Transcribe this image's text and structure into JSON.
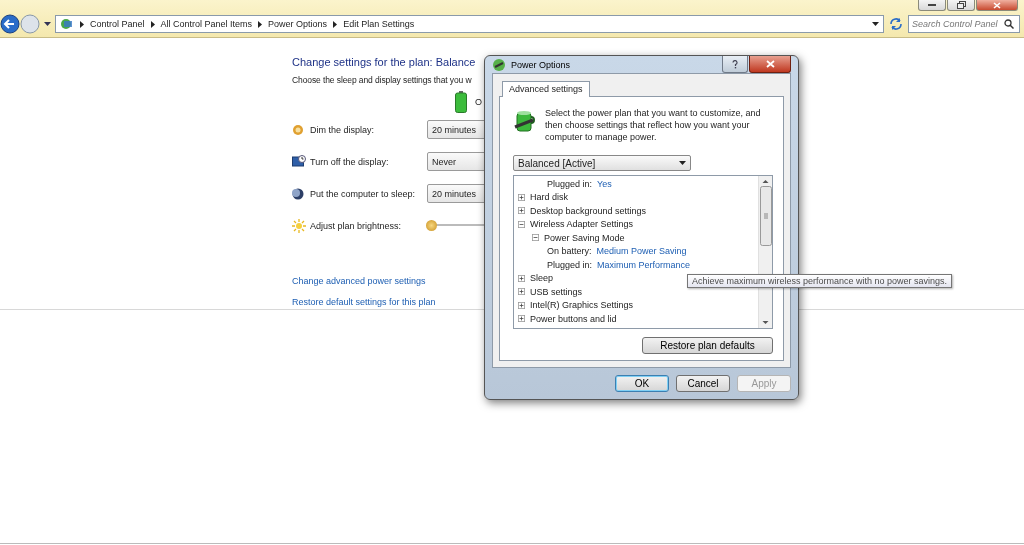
{
  "address_bar": {
    "crumbs": [
      "Control Panel",
      "All Control Panel Items",
      "Power Options",
      "Edit Plan Settings"
    ]
  },
  "search": {
    "placeholder": "Search Control Panel"
  },
  "page": {
    "title": "Change settings for the plan: Balance",
    "subtitle": "Choose the sleep and display settings that you w",
    "column_header": "O",
    "settings": [
      {
        "kind": "dropdown",
        "label": "Dim the display:",
        "value": "20 minutes"
      },
      {
        "kind": "dropdown",
        "label": "Turn off the display:",
        "value": "Never"
      },
      {
        "kind": "dropdown",
        "label": "Put the computer to sleep:",
        "value": "20 minutes"
      },
      {
        "kind": "slider",
        "label": "Adjust plan brightness:",
        "level": 0
      }
    ],
    "links": [
      "Change advanced power settings",
      "Restore default settings for this plan"
    ]
  },
  "dialog": {
    "title": "Power Options",
    "tabs": [
      {
        "label": "Advanced settings",
        "selected": true
      }
    ],
    "intro": "Select the power plan that you want to customize, and then choose settings that reflect how you want your computer to manage power.",
    "plan_dropdown": "Balanced [Active]",
    "tree": [
      {
        "children": [
          {
            "children": [
              {
                "kind": "value",
                "label": "Plugged in:",
                "value": "Yes"
              }
            ]
          }
        ]
      },
      {
        "kind": "group",
        "label": "Hard disk",
        "expanded": false
      },
      {
        "kind": "group",
        "label": "Desktop background settings",
        "expanded": false
      },
      {
        "kind": "group",
        "label": "Wireless Adapter Settings",
        "expanded": true,
        "children": [
          {
            "kind": "group",
            "label": "Power Saving Mode",
            "expanded": true,
            "children": [
              {
                "kind": "value",
                "label": "On battery:",
                "value": "Medium Power Saving"
              },
              {
                "kind": "value",
                "label": "Plugged in:",
                "value": "Maximum Performance"
              }
            ]
          }
        ]
      },
      {
        "kind": "group",
        "label": "Sleep",
        "expanded": false
      },
      {
        "kind": "group",
        "label": "USB settings",
        "expanded": false
      },
      {
        "kind": "group",
        "label": "Intel(R) Graphics Settings",
        "expanded": false
      },
      {
        "kind": "group",
        "label": "Power buttons and lid",
        "expanded": false
      }
    ],
    "restore_button": "Restore plan defaults",
    "buttons": [
      {
        "label": "OK",
        "default": true,
        "disabled": false
      },
      {
        "label": "Cancel",
        "default": false,
        "disabled": false
      },
      {
        "label": "Apply",
        "default": false,
        "disabled": true
      }
    ]
  },
  "tooltip": "Achieve maximum wireless performance with no power savings."
}
